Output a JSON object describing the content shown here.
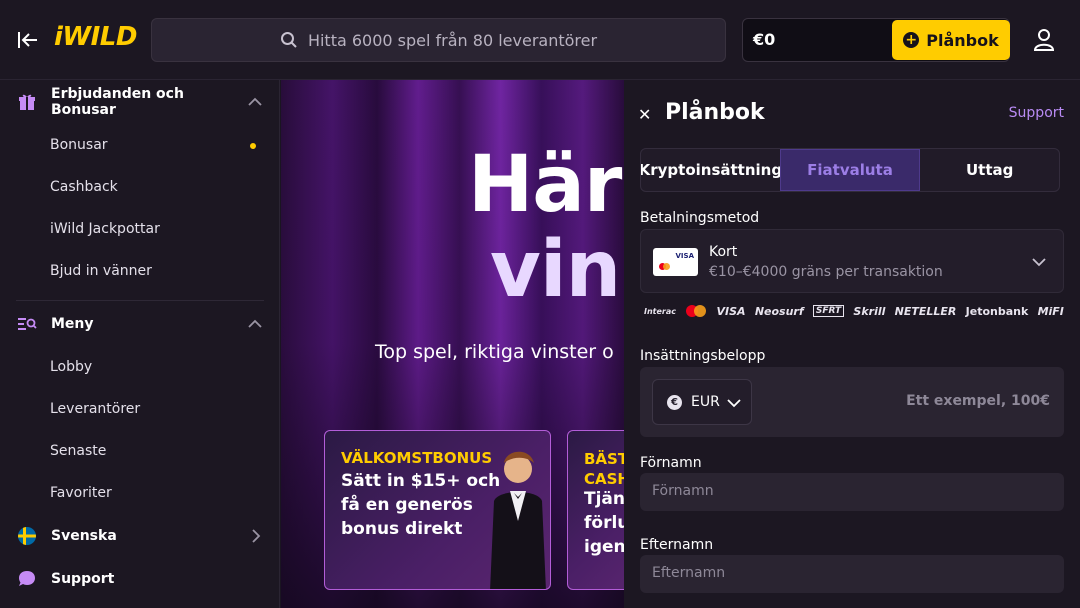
{
  "header": {
    "logo": "iWILD",
    "search_placeholder": "Hitta 6000 spel från 80 leverantörer",
    "balance": "€0",
    "wallet_button": "Plånbok"
  },
  "sidebar": {
    "offers_section": "Erbjudanden och Bonusar",
    "offers_items": [
      "Bonusar",
      "Cashback",
      "iWild Jackpottar",
      "Bjud in vänner"
    ],
    "menu_section": "Meny",
    "menu_items": [
      "Lobby",
      "Leverantörer",
      "Senaste",
      "Favoriter"
    ],
    "language": "Svenska",
    "support": "Support"
  },
  "hero": {
    "line1": "Här",
    "line2": "vinn",
    "subtitle": "Top spel, riktiga vinster o"
  },
  "promos": [
    {
      "title": "VÄLKOMSTBONUS",
      "body": "Sätt in $15+ och få en generös bonus direkt"
    },
    {
      "title": "BÄST CASH",
      "body": "Tjän förlu igen"
    }
  ],
  "wallet": {
    "title": "Plånbok",
    "support": "Support",
    "tabs": [
      "Kryptoinsättning",
      "Fiatvaluta",
      "Uttag"
    ],
    "active_tab": "Fiatvaluta",
    "payment_method_label": "Betalningsmetod",
    "method_name": "Kort",
    "method_desc": "€10–€4000 gräns per transaktion",
    "card_brand": "VISA",
    "providers": [
      "Interac",
      "Mastercard",
      "VISA",
      "Neosurf",
      "SFRT",
      "Skrill",
      "NETELLER",
      "Jetonbank",
      "MiFI"
    ],
    "amount_label": "Insättningsbelopp",
    "currency": "EUR",
    "currency_symbol": "€",
    "amount_placeholder": "Ett exempel, 100€",
    "firstname_label": "Förnamn",
    "firstname_placeholder": "Förnamn",
    "lastname_label": "Efternamn",
    "lastname_placeholder": "Efternamn"
  },
  "colors": {
    "brand_yellow": "#ffcc00",
    "accent_purple": "#b98bf5",
    "background": "#1c1722"
  }
}
